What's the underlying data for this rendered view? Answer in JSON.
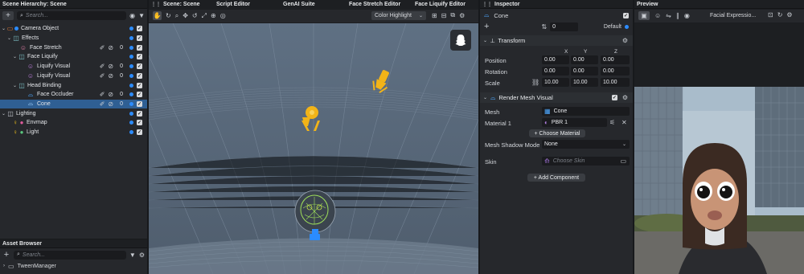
{
  "hierarchy": {
    "title": "Scene Hierarchy: Scene",
    "search_placeholder": "Search...",
    "items": [
      {
        "label": "Camera Object",
        "badge": ""
      },
      {
        "label": "Effects",
        "badge": ""
      },
      {
        "label": "Face Stretch",
        "badge": "0"
      },
      {
        "label": "Face Liquify",
        "badge": ""
      },
      {
        "label": "Liquify Visual",
        "badge": "0"
      },
      {
        "label": "Liquify Visual",
        "badge": "0"
      },
      {
        "label": "Head Binding",
        "badge": ""
      },
      {
        "label": "Face Occluder",
        "badge": "0"
      },
      {
        "label": "Cone",
        "badge": "0"
      },
      {
        "label": "Lighting",
        "badge": ""
      },
      {
        "label": "Envmap",
        "badge": ""
      },
      {
        "label": "Light",
        "badge": ""
      }
    ]
  },
  "asset_browser": {
    "title": "Asset Browser",
    "search_placeholder": "Search...",
    "first_item": "TweenManager"
  },
  "tabs": {
    "scene": "Scene: Scene",
    "script_editor": "Script Editor",
    "genai": "GenAI Suite",
    "face_stretch": "Face Stretch Editor",
    "face_liquify": "Face Liquify Editor"
  },
  "viewport": {
    "color_mode": "Color Highlight"
  },
  "inspector": {
    "title": "Inspector",
    "object_name": "Cone",
    "layer_count": "0",
    "layer_name": "Default",
    "transform": {
      "title": "Transform",
      "axes": [
        "X",
        "Y",
        "Z"
      ],
      "position_label": "Position",
      "rotation_label": "Rotation",
      "scale_label": "Scale",
      "position": [
        "0.00",
        "0.00",
        "0.00"
      ],
      "rotation": [
        "0.00",
        "0.00",
        "0.00"
      ],
      "scale": [
        "10.00",
        "10.00",
        "10.00"
      ]
    },
    "render": {
      "title": "Render Mesh Visual",
      "mesh_label": "Mesh",
      "mesh_value": "Cone",
      "material_label": "Material 1",
      "material_value": "PBR 1",
      "choose_material": "+ Choose Material",
      "shadow_label": "Mesh Shadow Mode",
      "shadow_value": "None",
      "skin_label": "Skin",
      "skin_placeholder": "Choose Skin"
    },
    "add_component": "+ Add Component"
  },
  "preview": {
    "title": "Preview",
    "lens_name": "Facial Expressio..."
  },
  "colors": {
    "accent": "#2c8cff",
    "selection": "#2f5f93",
    "viewport_bg": "#5b6b7d",
    "gizmo": "#f2b418"
  }
}
